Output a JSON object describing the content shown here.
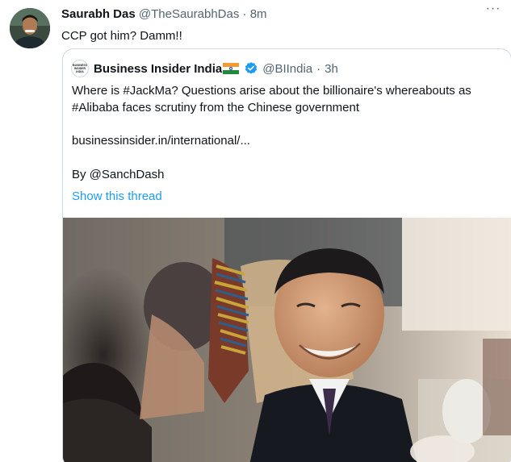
{
  "tweet": {
    "author_name": "Saurabh Das",
    "handle": "@TheSaurabhDas",
    "separator": "·",
    "time": "8m",
    "text": "CCP got him? Damm!!",
    "more_icon": "more-horizontal-icon"
  },
  "quoted": {
    "logo_text": [
      "BUSINESS",
      "INSIDER",
      "INDIA"
    ],
    "author_name": "Business Insider India",
    "flag_icon": "india-flag-icon",
    "verified_icon": "verified-badge-icon",
    "handle": "@BIIndia",
    "separator": "·",
    "time": "3h",
    "text_line1": "Where is #JackMa? Questions arise about the billionaire's whereabouts as",
    "text_line2": "#Alibaba faces scrutiny from the Chinese government",
    "link": "businessinsider.in/international/...",
    "byline": "By @SanchDash",
    "show_thread": "Show this thread"
  },
  "colors": {
    "accent": "#1d9bf0",
    "secondary_text": "#536471",
    "border": "#cfd9de"
  }
}
